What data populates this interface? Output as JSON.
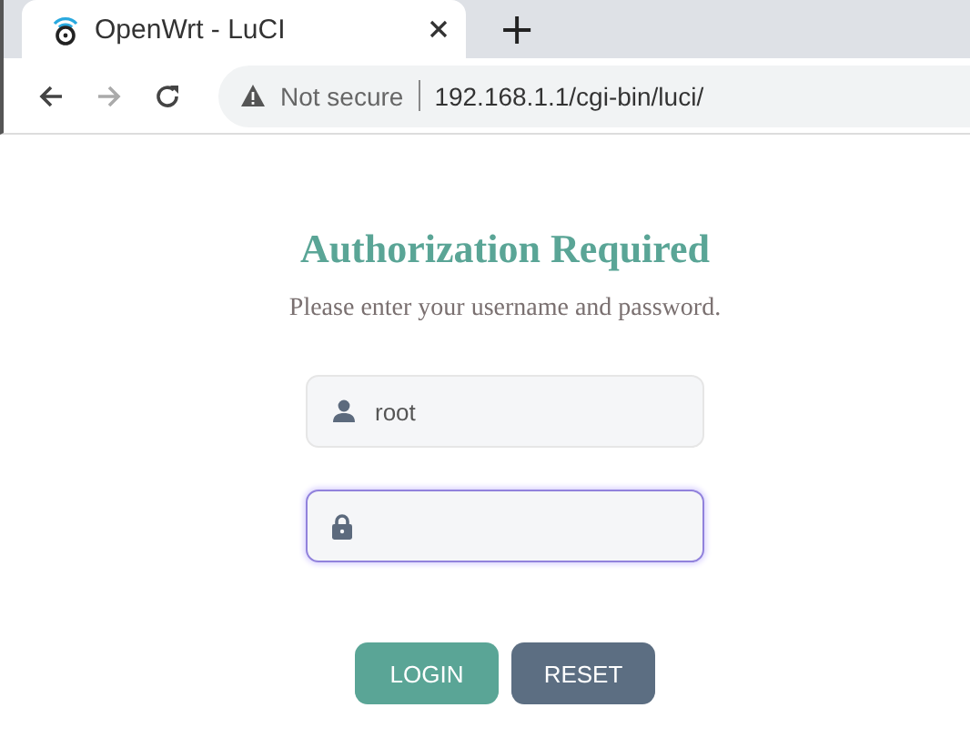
{
  "browser": {
    "tab": {
      "title": "OpenWrt - LuCI",
      "selected": true
    },
    "new_tab": "+",
    "security": "Not secure",
    "url": "192.168.1.1/cgi-bin/luci/"
  },
  "login": {
    "title": "Authorization Required",
    "subtitle": "Please enter your username and password.",
    "fields": [
      {
        "kind": "username",
        "value": "root",
        "focused": false
      },
      {
        "kind": "password",
        "focused": true
      }
    ],
    "buttons": [
      {
        "label": "LOGIN",
        "kind": "primary"
      },
      {
        "label": "RESET",
        "kind": "secondary"
      }
    ]
  }
}
